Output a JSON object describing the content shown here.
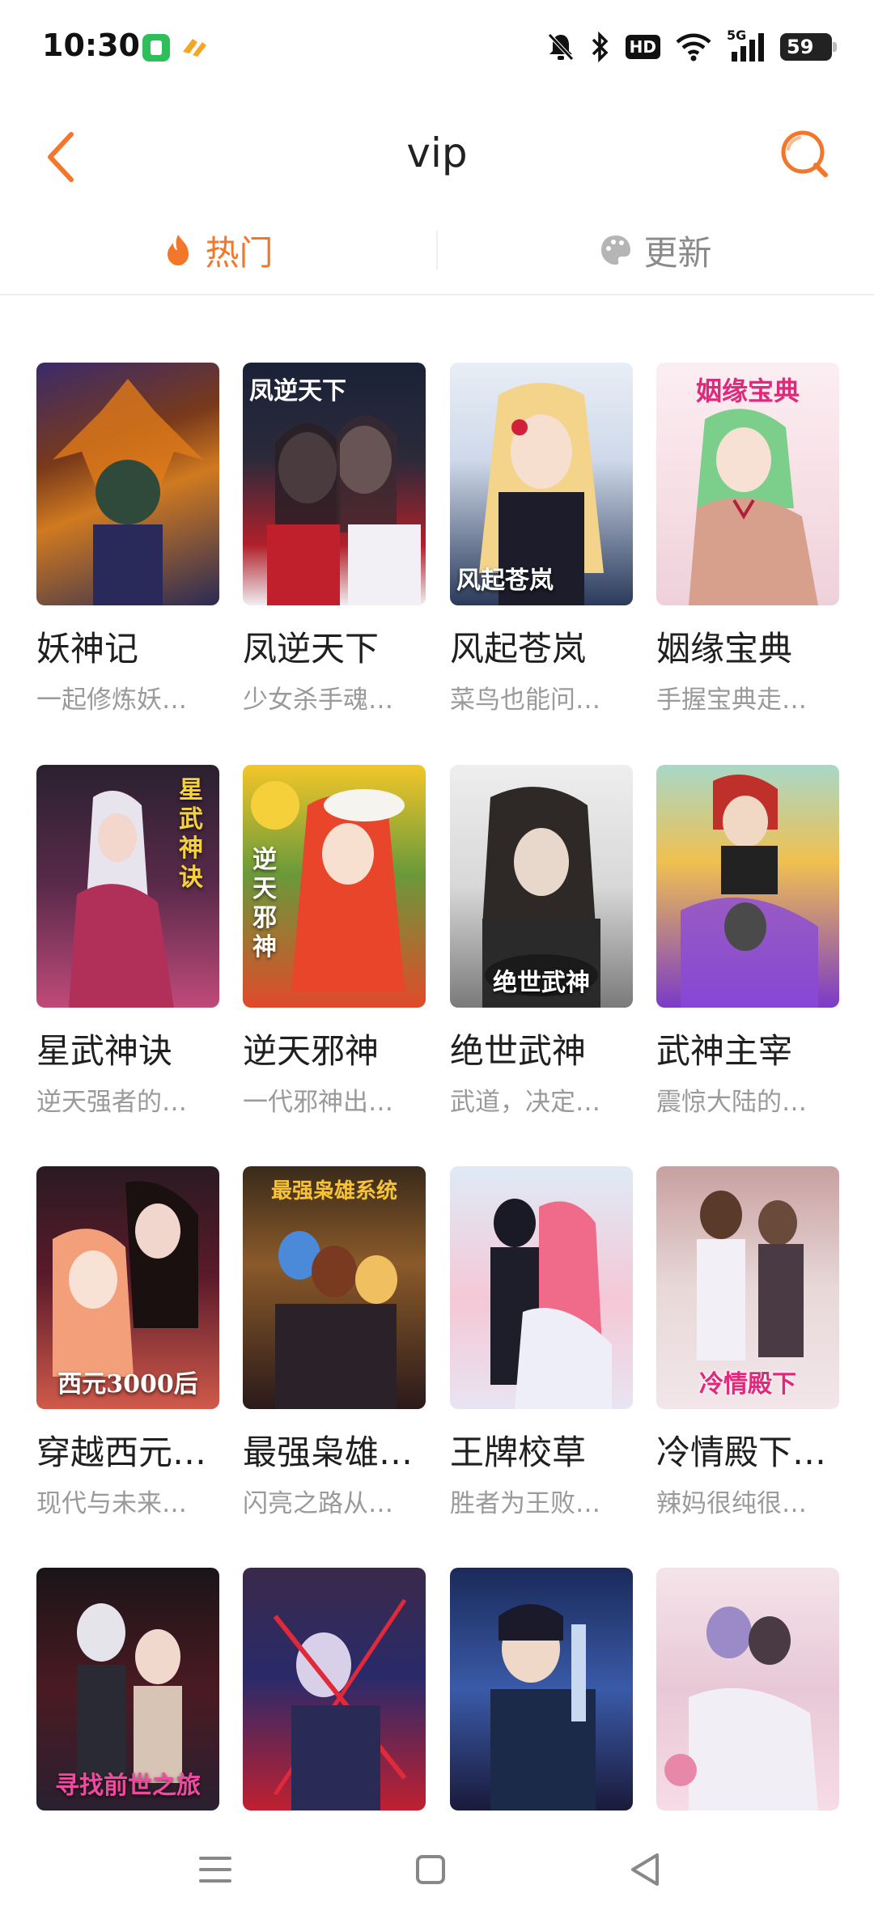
{
  "status_bar": {
    "time": "10:30",
    "hd": "HD",
    "network": "5G",
    "battery": "59"
  },
  "header": {
    "title": "vip",
    "accent_color": "#f2772a"
  },
  "tabs": [
    {
      "label": "热门",
      "active": true
    },
    {
      "label": "更新",
      "active": false
    }
  ],
  "comics": [
    {
      "name": "妖神记",
      "desc": "一起修炼妖…",
      "cover_text": ""
    },
    {
      "name": "凤逆天下",
      "desc": "少女杀手魂…",
      "cover_text": "凤逆天下"
    },
    {
      "name": "风起苍岚",
      "desc": "菜鸟也能问…",
      "cover_text": "风起苍岚"
    },
    {
      "name": "姻缘宝典",
      "desc": "手握宝典走…",
      "cover_text": "姻缘宝典"
    },
    {
      "name": "星武神诀",
      "desc": "逆天强者的…",
      "cover_text": "星武神诀"
    },
    {
      "name": "逆天邪神",
      "desc": "一代邪神出…",
      "cover_text": "逆天邪神"
    },
    {
      "name": "绝世武神",
      "desc": "武道，决定…",
      "cover_text": "绝世武神"
    },
    {
      "name": "武神主宰",
      "desc": "震惊大陆的…",
      "cover_text": ""
    },
    {
      "name": "穿越西元…",
      "desc": "现代与未来…",
      "cover_text": "西元3000后"
    },
    {
      "name": "最强枭雄…",
      "desc": "闪亮之路从…",
      "cover_text": "最强枭雄系统"
    },
    {
      "name": "王牌校草",
      "desc": "胜者为王败…",
      "cover_text": ""
    },
    {
      "name": "冷情殿下…",
      "desc": "辣妈很纯很…",
      "cover_text": "冷情殿下"
    },
    {
      "name": "",
      "desc": "",
      "cover_text": "寻找前世之旅"
    },
    {
      "name": "",
      "desc": "",
      "cover_text": ""
    },
    {
      "name": "",
      "desc": "",
      "cover_text": ""
    },
    {
      "name": "",
      "desc": "",
      "cover_text": ""
    }
  ]
}
